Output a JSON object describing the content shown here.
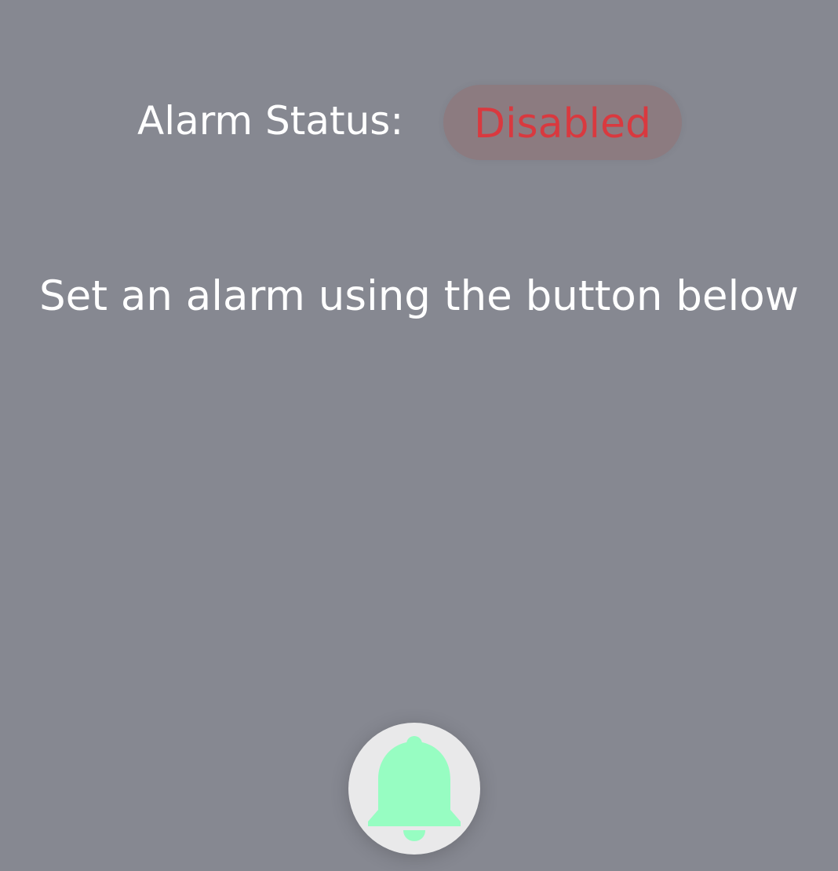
{
  "status": {
    "label": "Alarm Status:",
    "value": "Disabled",
    "value_color": "#d9393f"
  },
  "hint": {
    "text": "Set an alarm using the button below"
  },
  "alarm_button": {
    "icon": "bell-icon",
    "icon_color": "#97fdc2"
  },
  "colors": {
    "background": "#868891",
    "button_background": "#e9e9ea"
  }
}
